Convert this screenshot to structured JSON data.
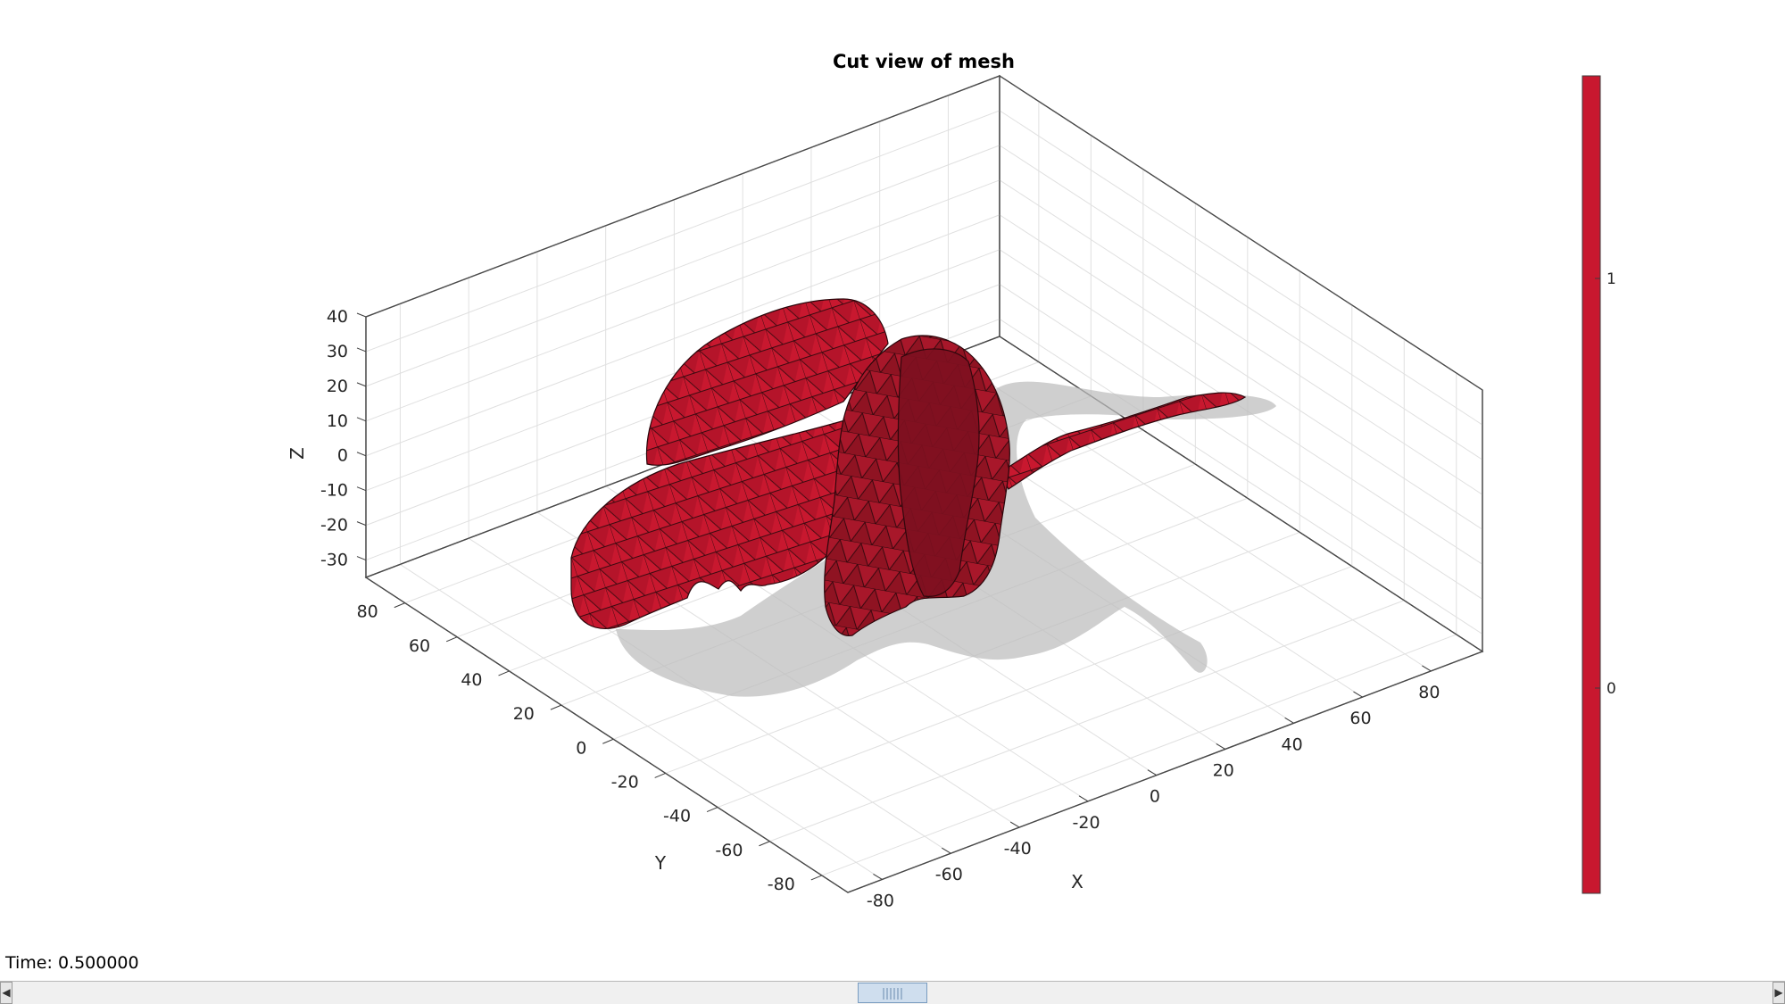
{
  "figure": {
    "title": "Cut view of mesh",
    "time_label": "Time: 0.500000",
    "mesh_color": "#c8182f",
    "shadow_color": "#bdbdbd"
  },
  "chart_data": {
    "type": "3d-surface",
    "title": "Cut view of mesh",
    "xlabel": "X",
    "ylabel": "Y",
    "zlabel": "Z",
    "x_ticks": [
      "-80",
      "-60",
      "-40",
      "-20",
      "0",
      "20",
      "40",
      "60",
      "80"
    ],
    "y_ticks": [
      "80",
      "60",
      "40",
      "20",
      "0",
      "-20",
      "-40",
      "-60",
      "-80"
    ],
    "z_ticks": [
      "40",
      "30",
      "20",
      "10",
      "0",
      "-10",
      "-20",
      "-30"
    ],
    "xlim": [
      -90,
      95
    ],
    "ylim": [
      -90,
      95
    ],
    "zlim": [
      -35,
      40
    ],
    "grid": true,
    "colorbar": {
      "ticks": [
        "1",
        "0"
      ],
      "color": "#c8182f",
      "position": "right"
    }
  },
  "slider": {
    "value": 0.5,
    "left_arrow": "◀",
    "right_arrow": "▶"
  }
}
